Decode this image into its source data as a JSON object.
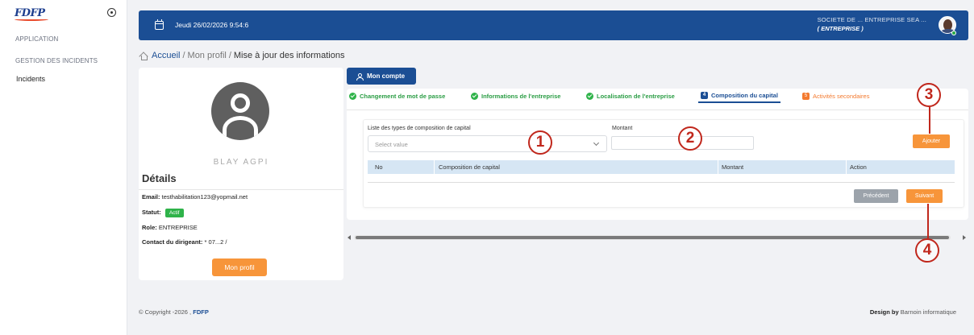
{
  "sidebar": {
    "logo": "FDFP",
    "sections": [
      "APPLICATION",
      "GESTION DES INCIDENTS"
    ],
    "items": [
      {
        "label": "Incidents"
      }
    ]
  },
  "header": {
    "date": "Jeudi 26/02/2026 9:54:6",
    "company": "SOCIETE DE ... ENTREPRISE SEA ...",
    "role": "( ENTREPRISE )"
  },
  "breadcrumb": {
    "home": "Accueil",
    "sep1": "/",
    "profile": "Mon profil",
    "sep2": "/",
    "current": "Mise à jour des informations"
  },
  "profile": {
    "name": "BLAY AGPI",
    "details_title": "Détails",
    "email_label": "Email:",
    "email": "testhabilitation123@yopmail.net",
    "statut_label": "Statut:",
    "statut": "Actif",
    "role_label": "Role:",
    "role": "ENTREPRISE",
    "contact_label": "Contact du dirigeant:",
    "contact": "* 07...2 /",
    "button": "Mon profil"
  },
  "account_button": "Mon compte",
  "tabs": [
    {
      "label": "Changement de mot de passe",
      "state": "done"
    },
    {
      "label": "Informations de l'entreprise",
      "state": "done"
    },
    {
      "label": "Localisation de l'entreprise",
      "state": "done"
    },
    {
      "label": "Composition du capital",
      "state": "active",
      "number": "4"
    },
    {
      "label": "Activités secondaires",
      "state": "pending",
      "number": "5"
    }
  ],
  "form": {
    "type_label": "Liste des types de composition de capital",
    "type_placeholder": "Select value",
    "montant_label": "Montant",
    "montant_value": "",
    "add_button": "Ajouter"
  },
  "table": {
    "columns": [
      "No",
      "Composition de capital",
      "Montant",
      "Action"
    ],
    "rows": []
  },
  "nav": {
    "previous": "Précédent",
    "next": "Suivant"
  },
  "annotations": [
    "1",
    "2",
    "3",
    "4"
  ],
  "footer": {
    "copyright": "© Copyright -2026 ,",
    "brand": "FDFP",
    "design_by": "Design by",
    "designer": "Barnoin informatique"
  },
  "colors": {
    "primary": "#1b4e94",
    "accent": "#f7953a",
    "success": "#2fb34a",
    "annotation": "#c0271c",
    "table_header": "#d6e6f4"
  }
}
